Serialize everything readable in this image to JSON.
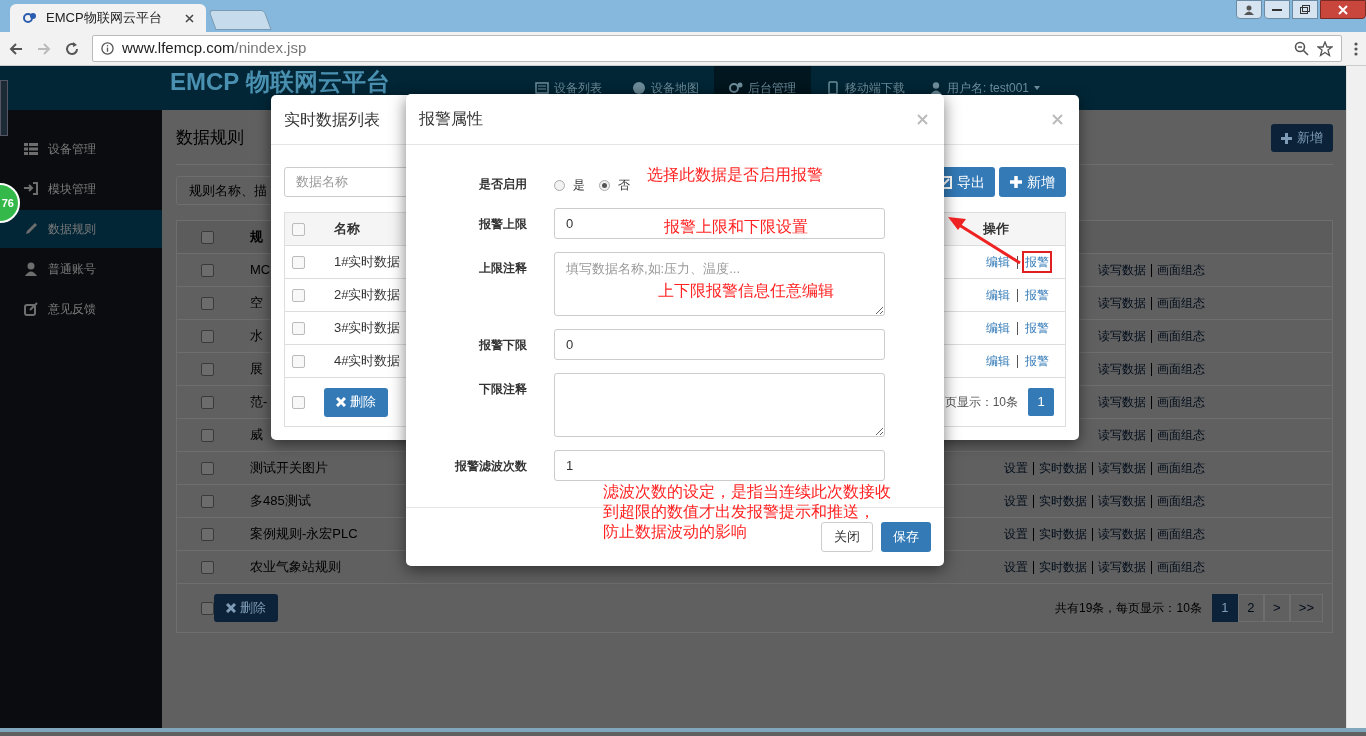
{
  "browser": {
    "tab_title": "EMCP物联网云平台",
    "url_host": "www.lfemcp.com",
    "url_path": "/nindex.jsp"
  },
  "floating_badge": "76",
  "navbar": {
    "logo": "EMCP 物联网云平台",
    "items": [
      {
        "label": "设备列表",
        "selected": false
      },
      {
        "label": "设备地图",
        "selected": false
      },
      {
        "label": "后台管理",
        "selected": true
      },
      {
        "label": "移动端下载",
        "selected": false
      }
    ],
    "user": "用户名: test001"
  },
  "sidebar": {
    "items": [
      {
        "label": "设备管理",
        "selected": false
      },
      {
        "label": "模块管理",
        "selected": false
      },
      {
        "label": "数据规则",
        "selected": true
      },
      {
        "label": "普通账号",
        "selected": false
      },
      {
        "label": "意见反馈",
        "selected": false
      }
    ]
  },
  "page": {
    "title": "数据规则",
    "add_button": "新增",
    "search_placeholder": "规则名称、描",
    "header": "规",
    "select_all_checked": false,
    "rows": [
      {
        "checked": false,
        "name": "MC",
        "actions": [
          "读写数据",
          "画面组态"
        ]
      },
      {
        "checked": false,
        "name": "空",
        "actions": [
          "读写数据",
          "画面组态"
        ]
      },
      {
        "checked": false,
        "name": "水",
        "actions": [
          "读写数据",
          "画面组态"
        ]
      },
      {
        "checked": false,
        "name": "展",
        "actions": [
          "读写数据",
          "画面组态"
        ]
      },
      {
        "checked": false,
        "name": "范-",
        "actions": [
          "读写数据",
          "画面组态"
        ]
      },
      {
        "checked": false,
        "name": "威",
        "actions": [
          "读写数据",
          "画面组态"
        ]
      },
      {
        "checked": false,
        "name": "测试开关图片",
        "actions": [
          "设置",
          "实时数据",
          "读写数据",
          "画面组态"
        ]
      },
      {
        "checked": false,
        "name": "多485测试",
        "actions": [
          "设置",
          "实时数据",
          "读写数据",
          "画面组态"
        ]
      },
      {
        "checked": false,
        "name": "案例规则-永宏PLC",
        "actions": [
          "设置",
          "实时数据",
          "读写数据",
          "画面组态"
        ]
      },
      {
        "checked": false,
        "name": "农业气象站规则",
        "actions": [
          "设置",
          "实时数据",
          "读写数据",
          "画面组态"
        ]
      }
    ],
    "footer_checked": false,
    "delete_button": "删除",
    "summary": "共有19条，每页显示：10条",
    "pages": [
      {
        "label": "1",
        "selected": true
      },
      {
        "label": "2",
        "selected": false
      },
      {
        "label": ">",
        "selected": false
      },
      {
        "label": ">>",
        "selected": false
      }
    ]
  },
  "data_list_dialog": {
    "title": "实时数据列表",
    "search_placeholder": "数据名称",
    "export_button": "导出",
    "add_button": "新增",
    "select_all_checked": false,
    "columns": [
      "名称",
      "操作"
    ],
    "rows": [
      {
        "checked": false,
        "name": "1#实时数据",
        "actions": [
          {
            "label": "编辑",
            "highlighted": false
          },
          {
            "label": "报警",
            "highlighted": true
          }
        ]
      },
      {
        "checked": false,
        "name": "2#实时数据",
        "actions": [
          {
            "label": "编辑",
            "highlighted": false
          },
          {
            "label": "报警",
            "highlighted": false
          }
        ]
      },
      {
        "checked": false,
        "name": "3#实时数据",
        "actions": [
          {
            "label": "编辑",
            "highlighted": false
          },
          {
            "label": "报警",
            "highlighted": false
          }
        ]
      },
      {
        "checked": false,
        "name": "4#实时数据",
        "actions": [
          {
            "label": "编辑",
            "highlighted": false
          },
          {
            "label": "报警",
            "highlighted": false
          }
        ]
      }
    ],
    "footer_checked": false,
    "delete_button": "删除",
    "summary": "页显示：10条",
    "pages": [
      {
        "label": "1",
        "selected": true
      }
    ]
  },
  "alarm_dialog": {
    "title": "报警属性",
    "fields": [
      {
        "kind": "radio",
        "label": "是否启用",
        "options": [
          {
            "label": "是",
            "selected": false
          },
          {
            "label": "否",
            "selected": true
          }
        ]
      },
      {
        "kind": "input",
        "label": "报警上限",
        "value": "0"
      },
      {
        "kind": "textarea",
        "label": "上限注释",
        "placeholder": "填写数据名称,如:压力、温度..."
      },
      {
        "kind": "input",
        "label": "报警下限",
        "value": "0"
      },
      {
        "kind": "textarea",
        "label": "下限注释"
      },
      {
        "kind": "input",
        "label": "报警滤波次数",
        "value": "1"
      }
    ],
    "buttons": [
      {
        "label": "关闭",
        "kind": "default"
      },
      {
        "label": "保存",
        "kind": "primary"
      }
    ]
  },
  "annotations": [
    {
      "lines": [
        "选择此数据是否启用报警"
      ]
    },
    {
      "lines": [
        "报警上限和下限设置"
      ]
    },
    {
      "lines": [
        "上下限报警信息任意编辑"
      ]
    },
    {
      "lines": [
        "滤波次数的设定，是指当连续此次数接收",
        "到超限的数值才出发报警提示和推送，",
        "防止数据波动的影响"
      ]
    }
  ]
}
